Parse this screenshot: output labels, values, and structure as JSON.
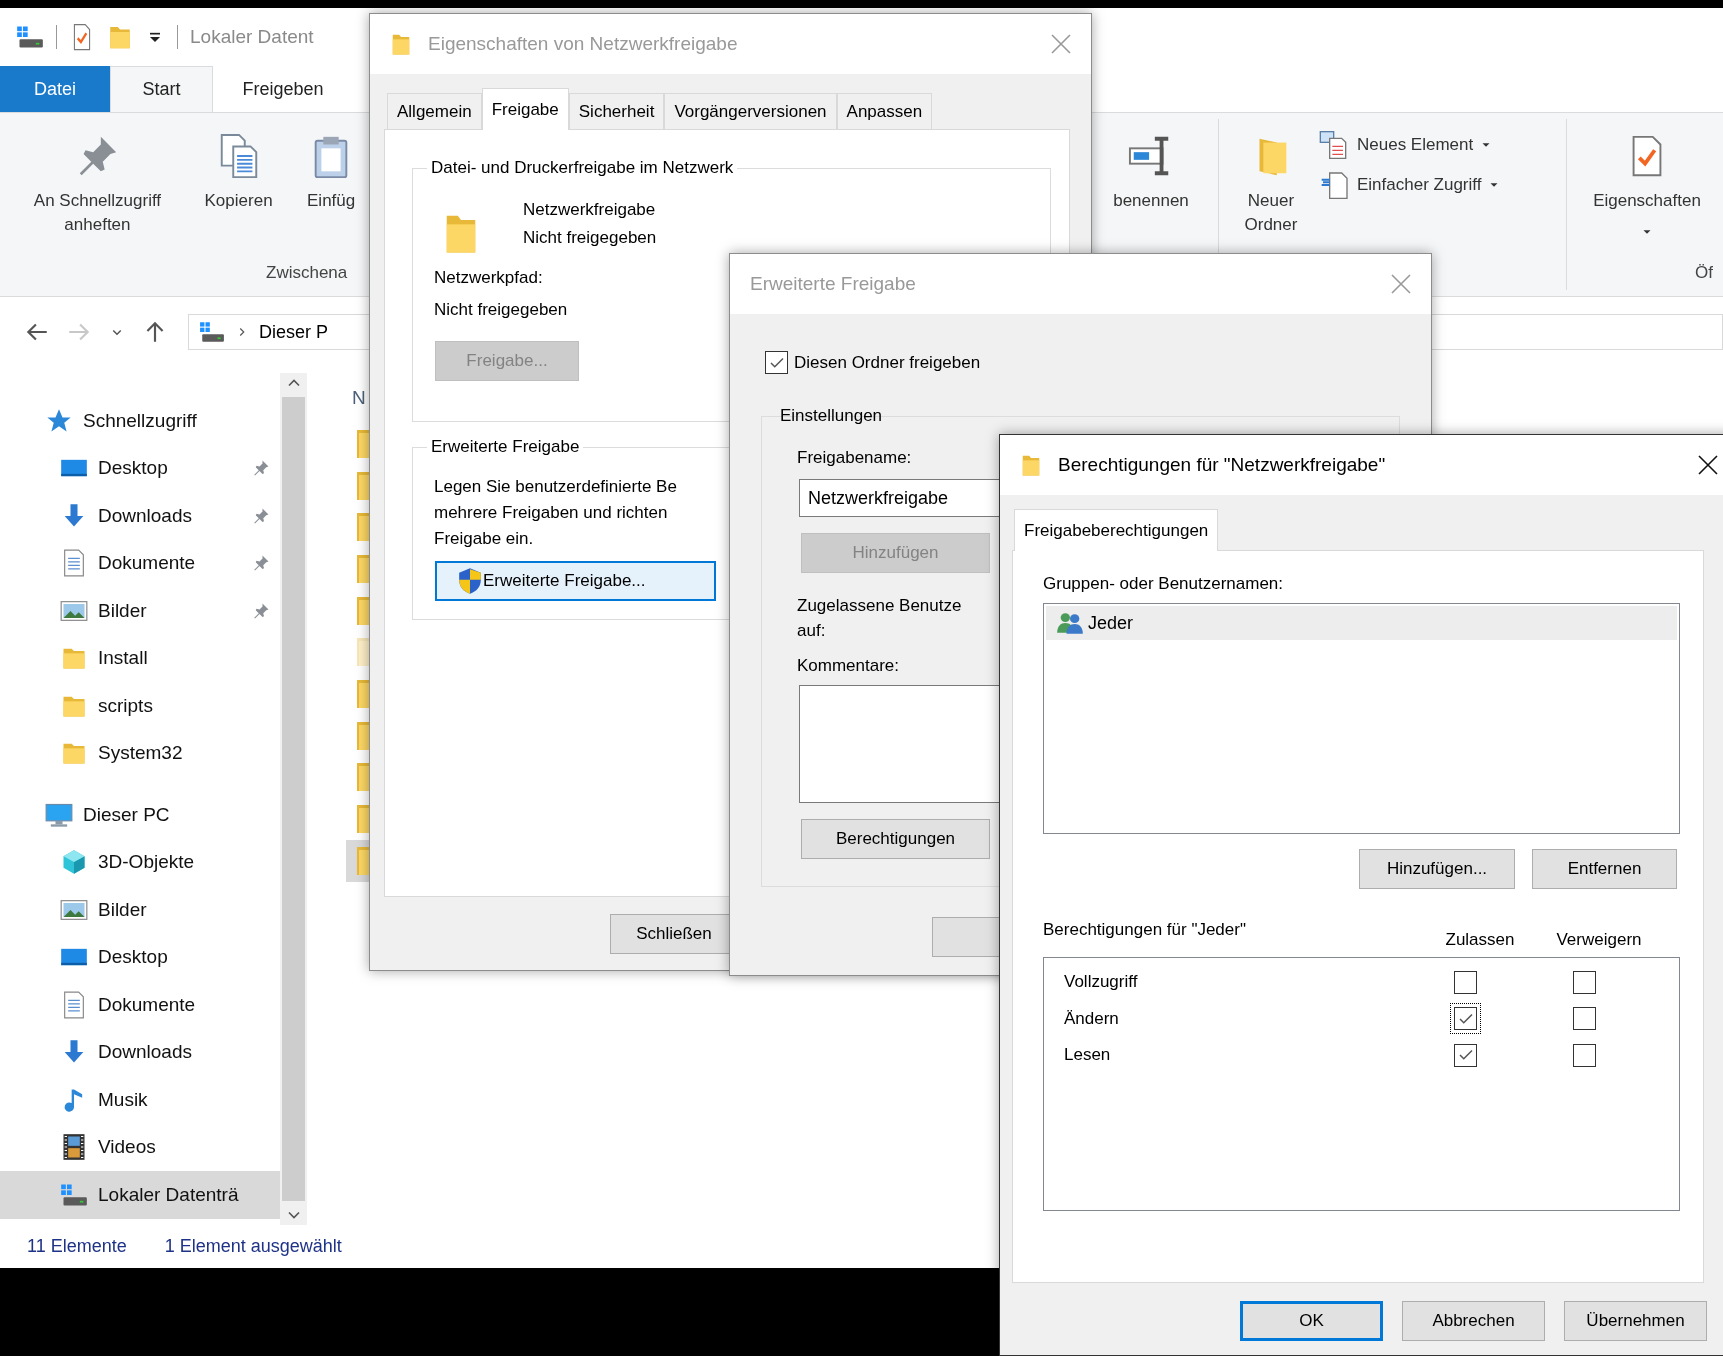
{
  "explorer": {
    "title": "Lokaler Datent",
    "ribbon_tabs": [
      {
        "label": "Datei",
        "kind": "backstage",
        "selected": false
      },
      {
        "label": "Start",
        "kind": "tab",
        "selected": true
      },
      {
        "label": "Freigeben",
        "kind": "tab",
        "selected": false
      }
    ],
    "clipboard_group": {
      "label": "Zwischena",
      "commands": [
        {
          "kind": "pin",
          "lines": [
            "An Schnellzugriff",
            "anheften"
          ]
        },
        {
          "kind": "copy",
          "lines": [
            "Kopieren"
          ]
        },
        {
          "kind": "paste",
          "lines": [
            "Einfüg"
          ]
        }
      ]
    },
    "organize_group": {
      "commands": [
        {
          "kind": "rename",
          "lines": [
            "benennen"
          ]
        }
      ]
    },
    "new_group": {
      "large": {
        "kind": "newfolder",
        "lines": [
          "Neuer",
          "Ordner"
        ]
      },
      "small": [
        {
          "kind": "newitem",
          "label": "Neues Element",
          "dropdown": true
        },
        {
          "kind": "easyaccess",
          "label": "Einfacher Zugriff",
          "dropdown": true
        }
      ]
    },
    "open_group": {
      "label": "Öf",
      "commands": [
        {
          "kind": "properties",
          "lines": [
            "Eigenschaften"
          ],
          "dropdown": true
        }
      ]
    },
    "nav_buttons": [
      {
        "kind": "back",
        "disabled": false
      },
      {
        "kind": "forward",
        "disabled": true
      },
      {
        "kind": "recent",
        "disabled": false
      },
      {
        "kind": "up",
        "disabled": false
      }
    ],
    "address": {
      "crumb": "Dieser P"
    },
    "nav": [
      {
        "label": "Schnellzugriff",
        "kind": "star",
        "selected": false,
        "children": [
          {
            "label": "Desktop",
            "kind": "desktop",
            "pinned": true,
            "selected": false
          },
          {
            "label": "Downloads",
            "kind": "downloads",
            "pinned": true,
            "selected": false
          },
          {
            "label": "Dokumente",
            "kind": "documents",
            "pinned": true,
            "selected": false
          },
          {
            "label": "Bilder",
            "kind": "pictures",
            "pinned": true,
            "selected": false
          },
          {
            "label": "Install",
            "kind": "folder",
            "pinned": false,
            "selected": false
          },
          {
            "label": "scripts",
            "kind": "folder",
            "pinned": false,
            "selected": false
          },
          {
            "label": "System32",
            "kind": "folder",
            "pinned": false,
            "selected": false
          }
        ]
      },
      {
        "label": "Dieser PC",
        "kind": "pc",
        "selected": false,
        "children": [
          {
            "label": "3D-Objekte",
            "kind": "cube",
            "pinned": false,
            "selected": false
          },
          {
            "label": "Bilder",
            "kind": "pictures",
            "pinned": false,
            "selected": false
          },
          {
            "label": "Desktop",
            "kind": "desktop",
            "pinned": false,
            "selected": false
          },
          {
            "label": "Dokumente",
            "kind": "documents",
            "pinned": false,
            "selected": false
          },
          {
            "label": "Downloads",
            "kind": "downloads",
            "pinned": false,
            "selected": false
          },
          {
            "label": "Musik",
            "kind": "music",
            "pinned": false,
            "selected": false
          },
          {
            "label": "Videos",
            "kind": "videos",
            "pinned": false,
            "selected": false
          },
          {
            "label": "Lokaler Datenträ",
            "kind": "drive",
            "pinned": false,
            "selected": true
          }
        ]
      }
    ],
    "file_list": {
      "column_1": "N",
      "rows": [
        {
          "hidden": false,
          "selected": false
        },
        {
          "hidden": false,
          "selected": false
        },
        {
          "hidden": false,
          "selected": false
        },
        {
          "hidden": false,
          "selected": false
        },
        {
          "hidden": false,
          "selected": false
        },
        {
          "hidden": true,
          "selected": false
        },
        {
          "hidden": false,
          "selected": false
        },
        {
          "hidden": false,
          "selected": false
        },
        {
          "hidden": false,
          "selected": false
        },
        {
          "hidden": false,
          "selected": false
        },
        {
          "hidden": false,
          "selected": true
        }
      ]
    },
    "status_bar": {
      "count": "11 Elemente",
      "selection": "1 Element ausgewählt"
    }
  },
  "properties_dialog": {
    "title": "Eigenschaften von Netzwerkfreigabe",
    "tabs": [
      {
        "label": "Allgemein",
        "selected": false
      },
      {
        "label": "Freigabe",
        "selected": true
      },
      {
        "label": "Sicherheit",
        "selected": false
      },
      {
        "label": "Vorgängerversionen",
        "selected": false
      },
      {
        "label": "Anpassen",
        "selected": false
      }
    ],
    "share_group": {
      "title": "Datei- und Druckerfreigabe im Netzwerk",
      "name": "Netzwerkfreigabe",
      "state": "Nicht freigegeben",
      "path_label": "Netzwerkpfad:",
      "path": "Nicht freigegeben",
      "button": {
        "label": "Freigabe...",
        "disabled": true
      }
    },
    "advanced_group": {
      "title": "Erweiterte Freigabe",
      "description_lines": [
        "Legen Sie benutzerdefinierte Be",
        "mehrere Freigaben und richten",
        "Freigabe ein."
      ],
      "button": {
        "label": "Erweiterte Freigabe...",
        "focused": true
      }
    },
    "close_button": "Schließen"
  },
  "advanced_dialog": {
    "title": "Erweiterte Freigabe",
    "share_checkbox": {
      "label": "Diesen Ordner freigeben",
      "checked": true
    },
    "settings": {
      "title": "Einstellungen",
      "name_label": "Freigabename:",
      "name_value": "Netzwerkfreigabe",
      "add_button": {
        "label": "Hinzufügen",
        "disabled": true
      },
      "limit_lines": [
        "Zugelassene Benutze",
        "auf:"
      ],
      "comment_label": "Kommentare:",
      "permissions_button": "Berechtigungen"
    }
  },
  "permissions_dialog": {
    "title": "Berechtigungen für \"Netzwerkfreigabe\"",
    "tabs": [
      {
        "label": "Freigabeberechtigungen",
        "selected": true
      }
    ],
    "principals_label": "Gruppen- oder Benutzernamen:",
    "principals": [
      {
        "label": "Jeder",
        "selected": true
      }
    ],
    "list_buttons": [
      "Hinzufügen...",
      "Entfernen"
    ],
    "permissions_label": "Berechtigungen für \"Jeder\"",
    "columns": [
      "Zulassen",
      "Verweigern"
    ],
    "permissions": [
      {
        "label": "Vollzugriff",
        "allow": false,
        "deny": false,
        "focused": false
      },
      {
        "label": "Ändern",
        "allow": true,
        "deny": false,
        "focused": true
      },
      {
        "label": "Lesen",
        "allow": true,
        "deny": false,
        "focused": false
      }
    ],
    "footer_buttons": [
      {
        "label": "OK",
        "default": true
      },
      {
        "label": "Abbrechen",
        "default": false
      },
      {
        "label": "Übernehmen",
        "default": false
      }
    ]
  }
}
